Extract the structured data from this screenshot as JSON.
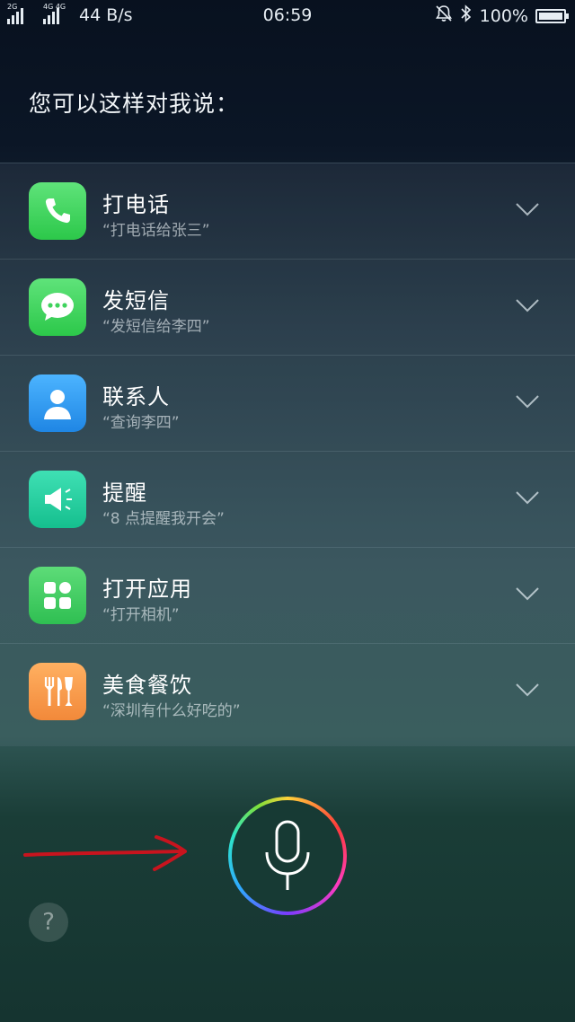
{
  "status_bar": {
    "sim1_tag": "2G",
    "sim2_tag": "4G 4G",
    "net_speed": "44 B/s",
    "time": "06:59",
    "battery": "100%",
    "battery_level_percent": 100,
    "icons": [
      "signal-icon",
      "alarm-off-icon",
      "bluetooth-icon",
      "battery-icon"
    ]
  },
  "prompt": "您可以这样对我说：",
  "commands": [
    {
      "title": "打电话",
      "hint": "“打电话给张三”",
      "icon": "phone-icon",
      "color": "#3fd35d"
    },
    {
      "title": "发短信",
      "hint": "“发短信给李四”",
      "icon": "message-icon",
      "color": "#3fd35d"
    },
    {
      "title": "联系人",
      "hint": "“查询李四”",
      "icon": "contacts-icon",
      "color": "#2f9cf0"
    },
    {
      "title": "提醒",
      "hint": "“8 点提醒我开会”",
      "icon": "reminder-icon",
      "color": "#22cfa0"
    },
    {
      "title": "打开应用",
      "hint": "“打开相机”",
      "icon": "apps-icon",
      "color": "#3ecb5a"
    },
    {
      "title": "美食餐饮",
      "hint": "“深圳有什么好吃的”",
      "icon": "food-icon",
      "color": "#f59a45"
    }
  ],
  "help_label": "?",
  "colors": {
    "arrow": "#c8141e",
    "mic_ring": [
      "#ffd23a",
      "#ff3b3b",
      "#ff3bbf",
      "#7a3bff",
      "#2fa8ff",
      "#2ee6c9",
      "#7ee03a"
    ]
  }
}
